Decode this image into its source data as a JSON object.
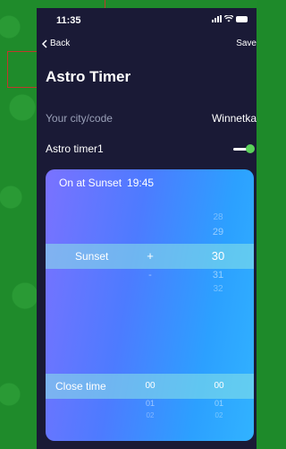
{
  "status": {
    "time": "11:35"
  },
  "nav": {
    "back_label": "Back",
    "save_label": "Save"
  },
  "page": {
    "title": "Astro Timer"
  },
  "city": {
    "label": "Your city/code",
    "value": "Winnetka"
  },
  "timer": {
    "label": "Astro timer1",
    "enabled": true,
    "toggle_color": "#5bd15b"
  },
  "card": {
    "heading_prefix": "On at Sunset",
    "heading_time": "19:45",
    "event_picker": {
      "selected": "Sunset"
    },
    "sign_picker": {
      "above": "",
      "selected": "+",
      "below": "-"
    },
    "minutes_picker": {
      "above2": "28",
      "above1": "29",
      "selected": "30",
      "below1": "31",
      "below2": "32"
    },
    "close_time": {
      "label": "Close time",
      "hours": {
        "selected": "00",
        "below1": "01",
        "below2": "02"
      },
      "minutes": {
        "selected": "00",
        "below1": "01",
        "below2": "02"
      }
    }
  },
  "colors": {
    "background_green": "#1f8b2b",
    "screen_bg": "#1a1a36",
    "card_blue": "#2ca0ff"
  }
}
